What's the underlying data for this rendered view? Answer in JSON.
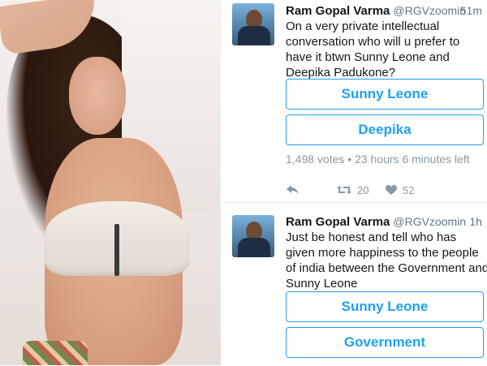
{
  "tweets": [
    {
      "name": "Ram Gopal Varma",
      "handle": "@RGVzoomin",
      "time": "51m",
      "text_lines": [
        "On a very private intellectual",
        "conversation who will u prefer to",
        "have it  btwn Sunny Leone and",
        "Deepika Padukone?"
      ],
      "options": [
        "Sunny Leone",
        "Deepika"
      ],
      "meta": "1,498 votes • 23 hours 6 minutes left",
      "retweets": "20",
      "likes": "52",
      "icons": [
        "reply-icon",
        "retweet-icon",
        "like-icon"
      ]
    },
    {
      "name": "Ram Gopal Varma",
      "handle": "@RGVzoomin",
      "time": "1h",
      "text_lines": [
        "Just be honest and tell who has",
        "given more happiness to the people",
        "of india between the Government and",
        "Sunny Leone"
      ],
      "options": [
        "Sunny Leone",
        "Government"
      ]
    }
  ],
  "colors": {
    "accent": "#1da1f2",
    "text": "#14171a",
    "muted": "#8899a6"
  }
}
